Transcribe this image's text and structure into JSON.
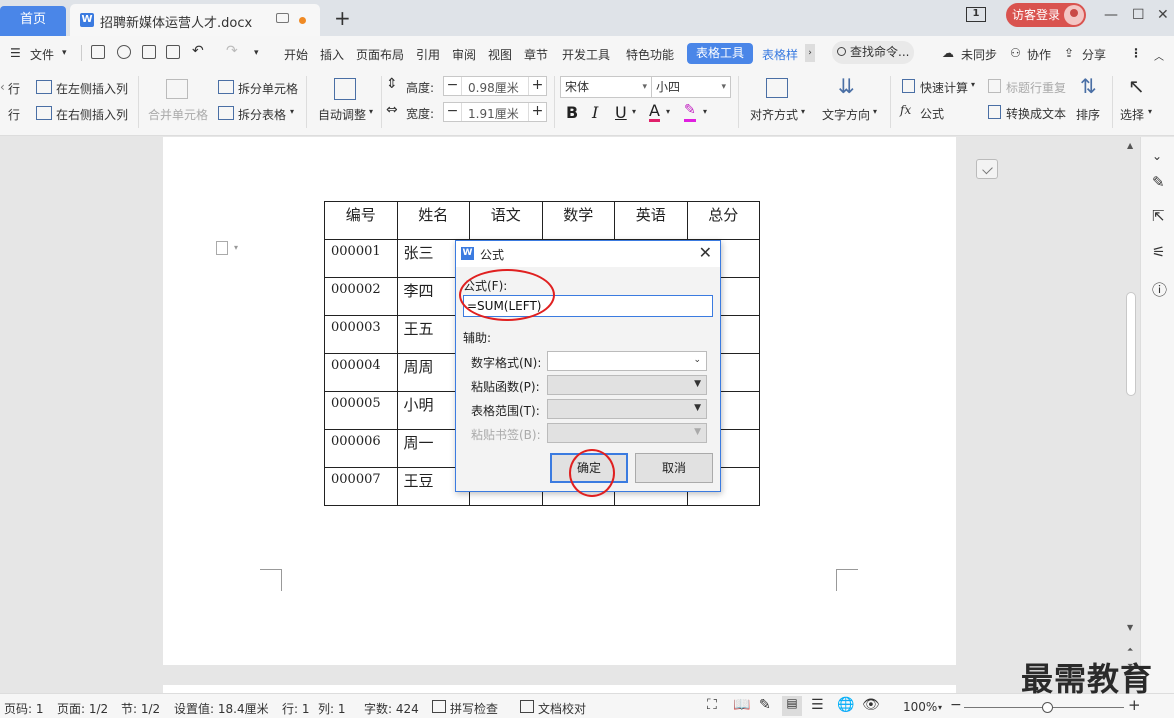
{
  "titlebar": {
    "home_tab": "首页",
    "doc_tab": "招聘新媒体运营人才.docx",
    "window_count": "1",
    "login": "访客登录",
    "controls": [
      "—",
      "☐",
      "✕"
    ]
  },
  "menubar": {
    "file": "文件",
    "items": [
      "开始",
      "插入",
      "页面布局",
      "引用",
      "审阅",
      "视图",
      "章节",
      "开发工具",
      "特色功能"
    ],
    "active_tab": "表格工具",
    "style_tab": "表格样",
    "search": "查找命令...",
    "sync": "未同步",
    "collab": "协作",
    "share": "分享"
  },
  "ribbon": {
    "insert_row_above": "行",
    "insert_row_below": "行",
    "insert_left": "在左侧插入列",
    "insert_right": "在右侧插入列",
    "merge": "合并单元格",
    "split_cell": "拆分单元格",
    "split_table": "拆分表格",
    "auto_fit": "自动调整",
    "height_label": "高度:",
    "height_value": "0.98厘米",
    "width_label": "宽度:",
    "width_value": "1.91厘米",
    "font": "宋体",
    "size": "小四",
    "bold": "B",
    "italic": "I",
    "underline": "U",
    "font_color": "A",
    "align": "对齐方式",
    "direction": "文字方向",
    "quick_calc": "快速计算",
    "repeat_header": "标题行重复",
    "formula": "公式",
    "to_text": "转换成文本",
    "sort": "排序",
    "select": "选择"
  },
  "table": {
    "headers": [
      "编号",
      "姓名",
      "语文",
      "数学",
      "英语",
      "总分"
    ],
    "rows": [
      [
        "000001",
        "张三"
      ],
      [
        "000002",
        "李四"
      ],
      [
        "000003",
        "王五"
      ],
      [
        "000004",
        "周周"
      ],
      [
        "000005",
        "小明"
      ],
      [
        "000006",
        "周一"
      ],
      [
        "000007",
        "王豆"
      ]
    ]
  },
  "dialog": {
    "title": "公式",
    "formula_label": "公式(F):",
    "formula_value": "=SUM(LEFT)",
    "assist_label": "辅助:",
    "number_format": "数字格式(N):",
    "paste_function": "粘贴函数(P):",
    "table_range": "表格范围(T):",
    "paste_bookmark": "粘贴书签(B):",
    "ok": "确定",
    "cancel": "取消"
  },
  "statusbar": {
    "page_num": "页码: 1",
    "pages": "页面: 1/2",
    "section": "节: 1/2",
    "setting": "设置值: 18.4厘米",
    "row": "行: 1",
    "col": "列: 1",
    "words": "字数: 424",
    "spell": "拼写检查",
    "proof": "文档校对",
    "zoom": "100%",
    "minus": "−",
    "plus": "+"
  },
  "watermark": "最需教育",
  "colors": {
    "accent": "#4a86e8",
    "annotation": "#e02020",
    "login": "#d9534f"
  }
}
